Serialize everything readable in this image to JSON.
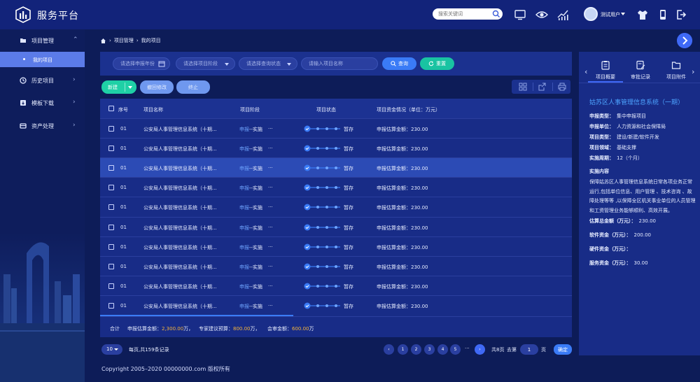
{
  "header": {
    "title": "服务平台",
    "search_placeholder": "搜索关键词",
    "user_name": "测试用户"
  },
  "sidebar": {
    "items": [
      {
        "label": "项目管理",
        "icon": "folder-icon"
      },
      {
        "label": "历史项目",
        "icon": "history-icon"
      },
      {
        "label": "模板下载",
        "icon": "download-icon"
      },
      {
        "label": "资产处理",
        "icon": "asset-icon"
      }
    ],
    "sub_item": "我的项目"
  },
  "breadcrumb": [
    "项目管理",
    "我的项目"
  ],
  "filters": {
    "year_placeholder": "请选择申报年份",
    "stage_placeholder": "请选择项目阶段",
    "status_placeholder": "请选择查询状态",
    "name_placeholder": "请输入项目名称",
    "query_label": "查询",
    "reset_label": "重置"
  },
  "actions": {
    "new_label": "新建",
    "recall_label": "撤回修改",
    "stop_label": "终止"
  },
  "table": {
    "headers": [
      "序号",
      "项目名称",
      "项目阶段",
      "项目状态",
      "项目资金情况（单位：万元）"
    ],
    "rows": [
      {
        "no": "01",
        "name": "公安局人事管理信息系统（十期...",
        "stage_a": "申报",
        "stage_b": "--实施",
        "stage_more": "···",
        "status": "暂存",
        "fund": "申报估算金额：230.00"
      },
      {
        "no": "01",
        "name": "公安局人事管理信息系统（十期...",
        "stage_a": "申报",
        "stage_b": "--实施",
        "stage_more": "···",
        "status": "暂存",
        "fund": "申报估算金额：230.00"
      },
      {
        "no": "01",
        "name": "公安局人事管理信息系统（十期...",
        "stage_a": "申报",
        "stage_b": "--实施",
        "stage_more": "···",
        "status": "暂存",
        "fund": "申报估算金额：230.00"
      },
      {
        "no": "01",
        "name": "公安局人事管理信息系统（十期...",
        "stage_a": "申报",
        "stage_b": "--实施",
        "stage_more": "···",
        "status": "暂存",
        "fund": "申报估算金额：230.00"
      },
      {
        "no": "01",
        "name": "公安局人事管理信息系统（十期...",
        "stage_a": "申报",
        "stage_b": "--实施",
        "stage_more": "···",
        "status": "暂存",
        "fund": "申报估算金额：230.00"
      },
      {
        "no": "01",
        "name": "公安局人事管理信息系统（十期...",
        "stage_a": "申报",
        "stage_b": "--实施",
        "stage_more": "···",
        "status": "暂存",
        "fund": "申报估算金额：230.00"
      },
      {
        "no": "01",
        "name": "公安局人事管理信息系统（十期...",
        "stage_a": "申报",
        "stage_b": "--实施",
        "stage_more": "···",
        "status": "暂存",
        "fund": "申报估算金额：230.00"
      },
      {
        "no": "01",
        "name": "公安局人事管理信息系统（十期...",
        "stage_a": "申报",
        "stage_b": "--实施",
        "stage_more": "···",
        "status": "暂存",
        "fund": "申报估算金额：230.00"
      },
      {
        "no": "01",
        "name": "公安局人事管理信息系统（十期...",
        "stage_a": "申报",
        "stage_b": "--实施",
        "stage_more": "···",
        "status": "暂存",
        "fund": "申报估算金额：230.00"
      },
      {
        "no": "01",
        "name": "公安局人事管理信息系统（十期...",
        "stage_a": "申报",
        "stage_b": "--实施",
        "stage_more": "···",
        "status": "暂存",
        "fund": "申报估算金额：230.00"
      }
    ],
    "footer": {
      "label": "合计",
      "declared_label": "申报估算金额：",
      "declared_value": "2,300.00",
      "declared_unit": "万，",
      "expert_label": "专家建议预算：",
      "expert_value": "800.00",
      "expert_unit": "万，",
      "audit_label": "会审金额：",
      "audit_value": "600.00",
      "audit_unit": "万"
    }
  },
  "pagination": {
    "page_size": "10",
    "summary": "每页,共159条记录",
    "pages": [
      "1",
      "2",
      "3",
      "4",
      "5"
    ],
    "ellipsis": "···",
    "total_pages_text": "共8页",
    "goto_text": "去第",
    "goto_value": "1",
    "page_unit": "页",
    "confirm_label": "确定"
  },
  "copyright": "Copyright 2005–2020 00000000.com 版权所有",
  "panel": {
    "tabs": [
      "项目概要",
      "审批记录",
      "项目附件"
    ],
    "title": "姑苏区人事管理信息系统（一期）",
    "fields": [
      {
        "k": "申报类型：",
        "v": "集中申报项目"
      },
      {
        "k": "申报单位：",
        "v": "人力资源和社会保障局"
      },
      {
        "k": "项目类型：",
        "v": "建设/新建/软件开发"
      },
      {
        "k": "项目领域：",
        "v": "基础支撑"
      },
      {
        "k": "实施周期：",
        "v": "12（个月）"
      }
    ],
    "content_label": "实施内容",
    "content": "保障姑苏区人事管理信息系统日常各项业务正常运行,包括单位信息、用户管理 、技术咨询 、故障处理等等 ,以保障全区机关事业单位的人员管理和工资管理业务能够顺利、高效开展。",
    "money": [
      {
        "k": "估算总金额（万元）：",
        "v": "230.00"
      },
      {
        "k": "软件资金（万元）：",
        "v": "200.00"
      },
      {
        "k": "硬件资金（万元）：",
        "v": ""
      },
      {
        "k": "服务资金（万元）：",
        "v": "30.00"
      }
    ]
  },
  "colors": {
    "bg": "#0d1c58",
    "header": "#12237a",
    "accent": "#3f69f6",
    "teal": "#19c3a2",
    "link": "#6ea4ff",
    "amount": "#f5b43b"
  }
}
